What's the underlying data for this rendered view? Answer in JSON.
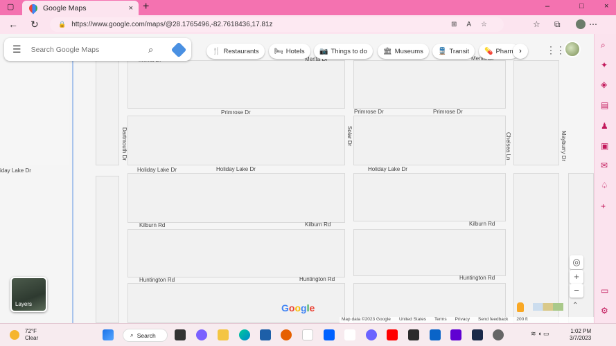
{
  "browser": {
    "tab_title": "Google Maps",
    "tab_close": "×",
    "new_tab": "+",
    "url": "https://www.google.com/maps/@28.1765496,-82.7618436,17.81z",
    "window_controls": {
      "minimize": "–",
      "maximize": "□",
      "close": "×"
    }
  },
  "search": {
    "placeholder": "Search Google Maps"
  },
  "chips": {
    "restaurants": "Restaurants",
    "hotels": "Hotels",
    "things": "Things to do",
    "museums": "Museums",
    "transit": "Transit",
    "pharmacies": "Pharm"
  },
  "roads": {
    "merita1": "Merita Dr",
    "merita2": "Merita Dr",
    "primrose1": "Primrose Dr",
    "primrose2": "Primrose Dr",
    "primrose3": "Primrose Dr",
    "dartmouth": "Dartmouth Dr",
    "solar": "Solar Dr",
    "chelsea": "Chelsea Ln",
    "mayburry": "Mayburry Dr",
    "holiday0": "iday Lake Dr",
    "holiday1": "Holiday Lake Dr",
    "holiday2": "Holiday Lake Dr",
    "holiday3": "Holiday Lake Dr",
    "kilburn1": "Kilburn Rd",
    "kilburn2": "Kilburn Rd",
    "kilburn3": "Kilburn Rd",
    "huntington1": "Huntington Rd",
    "huntington2": "Huntington Rd",
    "huntington3": "Huntington Rd"
  },
  "layers_label": "Layers",
  "logo": "Google",
  "footer": {
    "map_data": "Map data ©2023 Google",
    "country": "United States",
    "terms": "Terms",
    "privacy": "Privacy",
    "feedback": "Send feedback",
    "scale": "200 ft"
  },
  "taskbar": {
    "temp": "72°F",
    "condition": "Clear",
    "search": "Search",
    "time": "1:02 PM",
    "date": "3/7/2023"
  },
  "colors": {
    "titlebar": "#f472b0",
    "accent": "#c2185b"
  }
}
